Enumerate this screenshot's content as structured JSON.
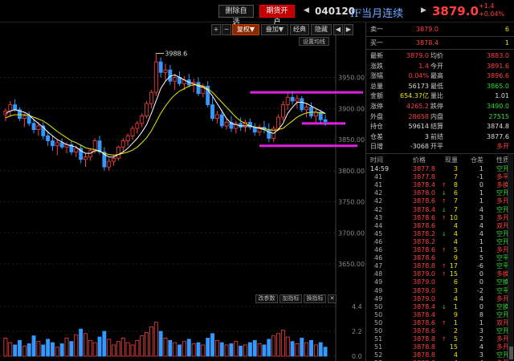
{
  "header": {
    "remove_label": "删除自选",
    "open_label": "期货开户",
    "code": "040120",
    "name": "IF当月连续",
    "price": "3879.0",
    "change": "+1.4",
    "change_pct": "+0.04%"
  },
  "toolbar": {
    "plus": "+",
    "minus": "−",
    "restore": "复权▼",
    "overlay": "叠加▼",
    "classic": "经典",
    "hide": "隐藏",
    "settings": "设置均线"
  },
  "sub_toolbar": {
    "params": "改参数",
    "add_indicator": "加指标",
    "switch_indicator": "换指标",
    "close": "✕"
  },
  "main_axis": {
    "labels": [
      "3950.00",
      "3900.00",
      "3850.00",
      "3800.00",
      "3750.00",
      "3700.00",
      "3650.00"
    ]
  },
  "vol_axis": {
    "labels": [
      "4.4",
      "2.2",
      "0.0"
    ]
  },
  "peak_label": "3988.6",
  "colors": {
    "up": "#ff4040",
    "down": "#33dd33",
    "ma5": "#ffffff",
    "ma10": "#e8e800",
    "ma20": "#cc44cc",
    "annot": "#e020e0"
  },
  "chart_data": {
    "type": "candlestick",
    "ylim": [
      3610,
      4010
    ],
    "peak": 3988.6,
    "candles": [
      [
        3890,
        3900,
        3880,
        3896
      ],
      [
        3896,
        3912,
        3888,
        3906
      ],
      [
        3906,
        3915,
        3895,
        3898
      ],
      [
        3898,
        3902,
        3880,
        3884
      ],
      [
        3884,
        3892,
        3870,
        3888
      ],
      [
        3888,
        3895,
        3872,
        3876
      ],
      [
        3876,
        3884,
        3860,
        3866
      ],
      [
        3866,
        3878,
        3856,
        3872
      ],
      [
        3872,
        3878,
        3850,
        3856
      ],
      [
        3856,
        3864,
        3840,
        3848
      ],
      [
        3848,
        3856,
        3832,
        3840
      ],
      [
        3840,
        3850,
        3825,
        3845
      ],
      [
        3845,
        3852,
        3835,
        3838
      ],
      [
        3838,
        3846,
        3828,
        3842
      ],
      [
        3842,
        3848,
        3825,
        3830
      ],
      [
        3830,
        3840,
        3822,
        3836
      ],
      [
        3836,
        3842,
        3812,
        3818
      ],
      [
        3818,
        3828,
        3806,
        3822
      ],
      [
        3822,
        3836,
        3816,
        3832
      ],
      [
        3832,
        3852,
        3828,
        3848
      ],
      [
        3848,
        3856,
        3826,
        3830
      ],
      [
        3830,
        3838,
        3800,
        3806
      ],
      [
        3806,
        3820,
        3800,
        3815
      ],
      [
        3815,
        3825,
        3808,
        3820
      ],
      [
        3820,
        3840,
        3816,
        3838
      ],
      [
        3838,
        3852,
        3830,
        3848
      ],
      [
        3848,
        3860,
        3840,
        3856
      ],
      [
        3856,
        3872,
        3850,
        3868
      ],
      [
        3868,
        3880,
        3860,
        3876
      ],
      [
        3876,
        3892,
        3870,
        3888
      ],
      [
        3888,
        3912,
        3884,
        3908
      ],
      [
        3908,
        3930,
        3900,
        3926
      ],
      [
        3926,
        3988.6,
        3920,
        3975
      ],
      [
        3975,
        3982,
        3950,
        3958
      ],
      [
        3958,
        3972,
        3945,
        3962
      ],
      [
        3962,
        3970,
        3938,
        3944
      ],
      [
        3944,
        3956,
        3930,
        3950
      ],
      [
        3950,
        3960,
        3936,
        3940
      ],
      [
        3940,
        3952,
        3930,
        3946
      ],
      [
        3946,
        3956,
        3934,
        3938
      ],
      [
        3938,
        3948,
        3926,
        3942
      ],
      [
        3942,
        3950,
        3920,
        3924
      ],
      [
        3924,
        3940,
        3918,
        3936
      ],
      [
        3936,
        3944,
        3902,
        3906
      ],
      [
        3906,
        3918,
        3880,
        3884
      ],
      [
        3884,
        3896,
        3876,
        3890
      ],
      [
        3890,
        3898,
        3868,
        3872
      ],
      [
        3872,
        3884,
        3866,
        3878
      ],
      [
        3878,
        3888,
        3862,
        3868
      ],
      [
        3868,
        3880,
        3860,
        3876
      ],
      [
        3876,
        3886,
        3864,
        3870
      ],
      [
        3870,
        3882,
        3862,
        3878
      ],
      [
        3878,
        3884,
        3866,
        3870
      ],
      [
        3870,
        3876,
        3856,
        3862
      ],
      [
        3862,
        3874,
        3856,
        3870
      ],
      [
        3870,
        3880,
        3860,
        3866
      ],
      [
        3866,
        3876,
        3846,
        3852
      ],
      [
        3852,
        3872,
        3846,
        3868
      ],
      [
        3868,
        3890,
        3864,
        3886
      ],
      [
        3886,
        3912,
        3880,
        3906
      ],
      [
        3906,
        3924,
        3898,
        3918
      ],
      [
        3918,
        3928,
        3906,
        3912
      ],
      [
        3912,
        3922,
        3900,
        3916
      ],
      [
        3916,
        3920,
        3894,
        3898
      ],
      [
        3898,
        3908,
        3886,
        3902
      ],
      [
        3902,
        3910,
        3884,
        3888
      ],
      [
        3888,
        3900,
        3878,
        3894
      ],
      [
        3894,
        3898,
        3876,
        3882
      ],
      [
        3882,
        3890,
        3872,
        3879
      ]
    ],
    "ma5": [
      3892,
      3896,
      3898,
      3896,
      3894,
      3890,
      3882,
      3876,
      3870,
      3862,
      3856,
      3850,
      3846,
      3842,
      3840,
      3838,
      3832,
      3828,
      3828,
      3832,
      3832,
      3826,
      3822,
      3822,
      3826,
      3830,
      3836,
      3844,
      3852,
      3862,
      3874,
      3892,
      3912,
      3932,
      3944,
      3952,
      3954,
      3950,
      3946,
      3942,
      3940,
      3936,
      3934,
      3930,
      3920,
      3908,
      3896,
      3884,
      3876,
      3874,
      3872,
      3872,
      3872,
      3870,
      3868,
      3866,
      3862,
      3860,
      3866,
      3876,
      3892,
      3902,
      3910,
      3910,
      3908,
      3904,
      3900,
      3896,
      3892
    ],
    "ma10": [
      3885,
      3888,
      3890,
      3890,
      3890,
      3889,
      3886,
      3883,
      3880,
      3875,
      3869,
      3863,
      3858,
      3853,
      3848,
      3845,
      3841,
      3837,
      3835,
      3834,
      3831,
      3828,
      3826,
      3825,
      3826,
      3828,
      3830,
      3833,
      3838,
      3845,
      3853,
      3864,
      3878,
      3892,
      3904,
      3914,
      3922,
      3928,
      3932,
      3936,
      3938,
      3938,
      3936,
      3932,
      3926,
      3918,
      3910,
      3902,
      3894,
      3886,
      3880,
      3876,
      3872,
      3870,
      3869,
      3868,
      3866,
      3865,
      3866,
      3868,
      3874,
      3880,
      3886,
      3890,
      3893,
      3894,
      3894,
      3893,
      3892
    ],
    "volume": [
      1.6,
      1.2,
      1.0,
      1.4,
      0.9,
      1.1,
      1.8,
      1.3,
      1.0,
      1.5,
      1.2,
      0.8,
      1.1,
      1.6,
      1.3,
      1.9,
      2.4,
      2.0,
      1.4,
      1.2,
      1.7,
      2.2,
      1.5,
      1.0,
      1.3,
      1.6,
      1.2,
      1.0,
      1.4,
      1.8,
      2.1,
      2.6,
      3.0,
      2.2,
      1.6,
      1.4,
      1.2,
      1.0,
      1.3,
      1.5,
      1.1,
      1.2,
      1.0,
      1.6,
      2.0,
      1.4,
      1.2,
      1.0,
      1.1,
      1.3,
      0.9,
      1.0,
      1.2,
      1.4,
      1.1,
      1.0,
      1.5,
      1.8,
      2.0,
      2.3,
      1.7,
      1.3,
      1.1,
      1.6,
      1.2,
      1.4,
      1.0,
      1.2,
      0.8
    ]
  },
  "right_panel": {
    "sell1": {
      "label": "卖一",
      "price": "3879.0",
      "qty": "6"
    },
    "buy1": {
      "label": "买一",
      "price": "3878.4",
      "qty": "1"
    },
    "stats": [
      {
        "l1": "最新",
        "v1": "3879.0",
        "c1": "red",
        "l2": "均价",
        "v2": "3883.0",
        "c2": "red"
      },
      {
        "l1": "涨跌",
        "v1": "1.4",
        "c1": "red",
        "l2": "今开",
        "v2": "3891.6",
        "c2": "red"
      },
      {
        "l1": "涨幅",
        "v1": "0.04%",
        "c1": "red",
        "l2": "最高",
        "v2": "3896.6",
        "c2": "red"
      },
      {
        "l1": "总量",
        "v1": "56173",
        "c1": "white",
        "l2": "最低",
        "v2": "3865.0",
        "c2": "green"
      },
      {
        "l1": "金额",
        "v1": "654.37亿",
        "c1": "yellow",
        "l2": "量比",
        "v2": "1.01",
        "c2": "white"
      },
      {
        "l1": "涨停",
        "v1": "4265.2",
        "c1": "red",
        "l2": "跌停",
        "v2": "3490.0",
        "c2": "green"
      },
      {
        "l1": "外盘",
        "v1": "28658",
        "c1": "red",
        "l2": "内盘",
        "v2": "27515",
        "c2": "green"
      },
      {
        "l1": "持仓",
        "v1": "59614",
        "c1": "white",
        "l2": "结算",
        "v2": "3874.8",
        "c2": "white"
      },
      {
        "l1": "仓差",
        "v1": "3",
        "c1": "white",
        "l2": "前结",
        "v2": "3877.6",
        "c2": "white"
      },
      {
        "l1": "日增",
        "v1": "-3068",
        "c1": "white",
        "l2": "开平",
        "v2": "多开",
        "c2": "red"
      }
    ],
    "ticks_header": {
      "time": "时间",
      "price": "价格",
      "vol": "现量",
      "oi": "仓差",
      "type": "性质"
    },
    "ticks": [
      {
        "t": "14:59",
        "p": "3877.8",
        "a": "",
        "v": "3",
        "o": "1",
        "k": "空开",
        "pc": "red",
        "kc": "green"
      },
      {
        "t": "41",
        "p": "3877.8",
        "a": "",
        "v": "7",
        "o": "-1",
        "k": "多平",
        "pc": "red",
        "kc": "red"
      },
      {
        "t": "41",
        "p": "3878.4",
        "a": "↑",
        "v": "8",
        "o": "0",
        "k": "多换",
        "pc": "red",
        "kc": "red"
      },
      {
        "t": "42",
        "p": "3878.0",
        "a": "↓",
        "v": "6",
        "o": "1",
        "k": "空开",
        "pc": "red",
        "kc": "green"
      },
      {
        "t": "42",
        "p": "3878.6",
        "a": "↑",
        "v": "7",
        "o": "1",
        "k": "多开",
        "pc": "red",
        "kc": "red"
      },
      {
        "t": "42",
        "p": "3878.4",
        "a": "↓",
        "v": "7",
        "o": "4",
        "k": "空开",
        "pc": "red",
        "kc": "green"
      },
      {
        "t": "43",
        "p": "3878.6",
        "a": "↑",
        "v": "10",
        "o": "3",
        "k": "多开",
        "pc": "red",
        "kc": "red"
      },
      {
        "t": "44",
        "p": "3878.6",
        "a": "",
        "v": "4",
        "o": "4",
        "k": "双开",
        "pc": "red",
        "kc": "red"
      },
      {
        "t": "45",
        "p": "3878.2",
        "a": "↓",
        "v": "4",
        "o": "4",
        "k": "空开",
        "pc": "red",
        "kc": "green"
      },
      {
        "t": "46",
        "p": "3878.2",
        "a": "",
        "v": "4",
        "o": "1",
        "k": "空开",
        "pc": "red",
        "kc": "green"
      },
      {
        "t": "46",
        "p": "3878.6",
        "a": "↑",
        "v": "5",
        "o": "1",
        "k": "多开",
        "pc": "red",
        "kc": "red"
      },
      {
        "t": "46",
        "p": "3878.6",
        "a": "",
        "v": "9",
        "o": "5",
        "k": "空平",
        "pc": "red",
        "kc": "green"
      },
      {
        "t": "47",
        "p": "3878.8",
        "a": "↑",
        "v": "17",
        "o": "-6",
        "k": "空平",
        "pc": "red",
        "kc": "green"
      },
      {
        "t": "48",
        "p": "3879.0",
        "a": "↑",
        "v": "15",
        "o": "0",
        "k": "多换",
        "pc": "red",
        "kc": "red"
      },
      {
        "t": "49",
        "p": "3879.0",
        "a": "",
        "v": "6",
        "o": "0",
        "k": "空换",
        "pc": "red",
        "kc": "green"
      },
      {
        "t": "49",
        "p": "3879.0",
        "a": "",
        "v": "3",
        "o": "-2",
        "k": "空平",
        "pc": "red",
        "kc": "green"
      },
      {
        "t": "49",
        "p": "3879.0",
        "a": "",
        "v": "4",
        "o": "4",
        "k": "多开",
        "pc": "red",
        "kc": "red"
      },
      {
        "t": "50",
        "p": "3878.4",
        "a": "↓",
        "v": "1",
        "o": "0",
        "k": "空换",
        "pc": "red",
        "kc": "green"
      },
      {
        "t": "50",
        "p": "3878.4",
        "a": "",
        "v": "9",
        "o": "8",
        "k": "空开",
        "pc": "red",
        "kc": "green"
      },
      {
        "t": "50",
        "p": "3878.6",
        "a": "↑",
        "v": "1",
        "o": "1",
        "k": "双开",
        "pc": "red",
        "kc": "red"
      },
      {
        "t": "50",
        "p": "3878.6",
        "a": "",
        "v": "2",
        "o": "3",
        "k": "空开",
        "pc": "red",
        "kc": "green"
      },
      {
        "t": "51",
        "p": "3878.8",
        "a": "↑",
        "v": "5",
        "o": "2",
        "k": "多开",
        "pc": "red",
        "kc": "red"
      },
      {
        "t": "51",
        "p": "3878.8",
        "a": "",
        "v": "15",
        "o": "4",
        "k": "多开",
        "pc": "red",
        "kc": "red"
      },
      {
        "t": "52",
        "p": "3878.8",
        "a": "",
        "v": "4",
        "o": "3",
        "k": "空开",
        "pc": "red",
        "kc": "green"
      },
      {
        "t": "53",
        "p": "3878.8",
        "a": "",
        "v": "4",
        "o": "4",
        "k": "多开",
        "pc": "red",
        "kc": "red"
      }
    ]
  }
}
